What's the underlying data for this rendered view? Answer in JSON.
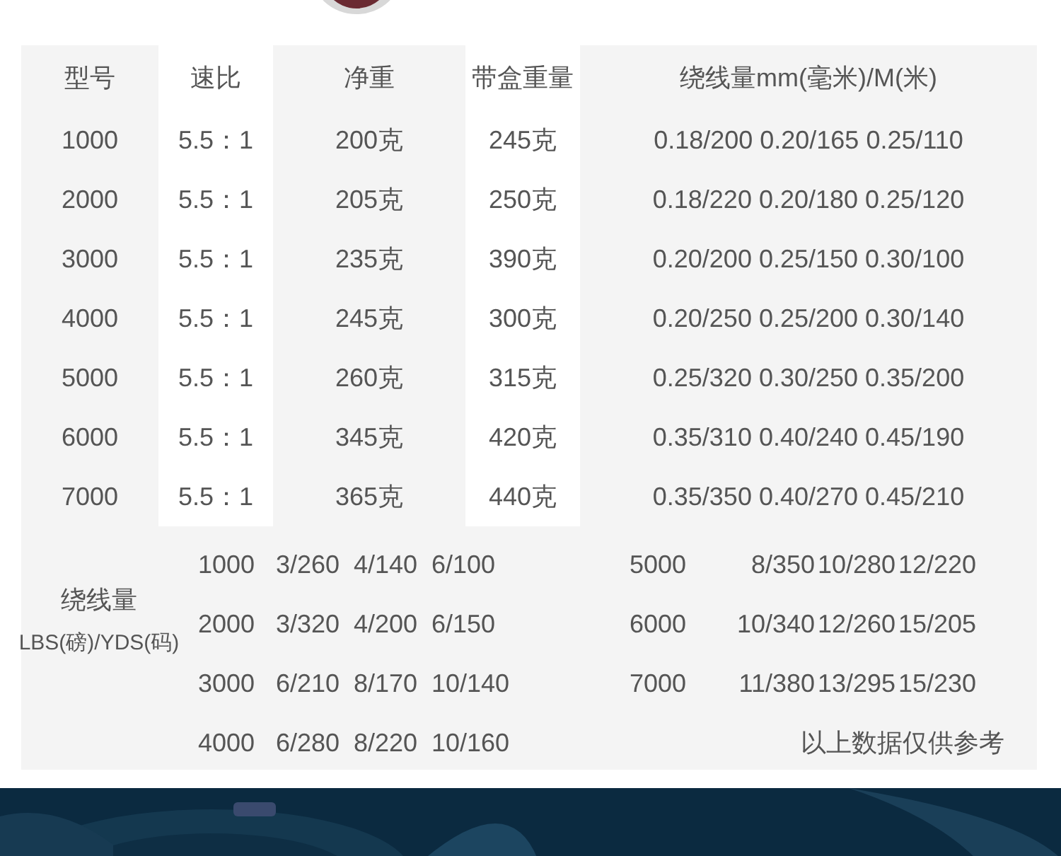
{
  "spec_table": {
    "columns": [
      "型号",
      "速比",
      "净重",
      "带盒重量",
      "绕线量mm(毫米)/M(米)"
    ],
    "rows": [
      {
        "model": "1000",
        "ratio": "5.5：1",
        "net_weight": "200克",
        "boxed_weight": "245克",
        "line_capacity": "0.18/200 0.20/165 0.25/110"
      },
      {
        "model": "2000",
        "ratio": "5.5：1",
        "net_weight": "205克",
        "boxed_weight": "250克",
        "line_capacity": "0.18/220 0.20/180 0.25/120"
      },
      {
        "model": "3000",
        "ratio": "5.5：1",
        "net_weight": "235克",
        "boxed_weight": "390克",
        "line_capacity": "0.20/200 0.25/150 0.30/100"
      },
      {
        "model": "4000",
        "ratio": "5.5：1",
        "net_weight": "245克",
        "boxed_weight": "300克",
        "line_capacity": "0.20/250 0.25/200 0.30/140"
      },
      {
        "model": "5000",
        "ratio": "5.5：1",
        "net_weight": "260克",
        "boxed_weight": "315克",
        "line_capacity": "0.25/320 0.30/250 0.35/200"
      },
      {
        "model": "6000",
        "ratio": "5.5：1",
        "net_weight": "345克",
        "boxed_weight": "420克",
        "line_capacity": "0.35/310 0.40/240 0.45/190"
      },
      {
        "model": "7000",
        "ratio": "5.5：1",
        "net_weight": "365克",
        "boxed_weight": "440克",
        "line_capacity": "0.35/350 0.40/270 0.45/210"
      }
    ]
  },
  "lbs_table": {
    "label": [
      "绕线量",
      "LBS(磅)/YDS(码)"
    ],
    "left_rows": [
      {
        "model": "1000",
        "values": [
          "3/260",
          "4/140",
          "6/100"
        ]
      },
      {
        "model": "2000",
        "values": [
          "3/320",
          "4/200",
          "6/150"
        ]
      },
      {
        "model": "3000",
        "values": [
          "6/210",
          "8/170",
          "10/140"
        ]
      },
      {
        "model": "4000",
        "values": [
          "6/280",
          "8/220",
          "10/160"
        ]
      }
    ],
    "right_rows": [
      {
        "model": "5000",
        "values": [
          "8/350",
          "10/280",
          "12/220"
        ]
      },
      {
        "model": "6000",
        "values": [
          "10/340",
          "12/260",
          "15/205"
        ]
      },
      {
        "model": "7000",
        "values": [
          "11/380",
          "13/295",
          "15/230"
        ]
      }
    ],
    "note": "以上数据仅供参考"
  }
}
